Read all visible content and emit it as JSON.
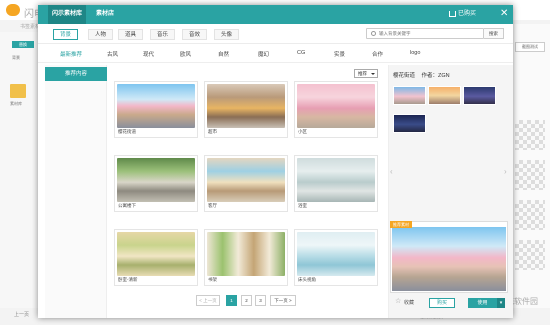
{
  "background_app": {
    "brand": "闪电",
    "subtitle": "书签素材",
    "left_button": "替换",
    "left_label_1": "背景",
    "left_label_2": "素材库",
    "bottom_text": "上一页",
    "bottom_right": "在线教程设计",
    "right_tab": "截图测试"
  },
  "watermark": "系统软件园",
  "dialog": {
    "tabs": [
      {
        "label": "闪示素材库"
      },
      {
        "label": "素材店"
      }
    ],
    "cart_label": "已购买",
    "close": "✕",
    "categories": [
      {
        "label": "背景"
      },
      {
        "label": "人物"
      },
      {
        "label": "道具"
      },
      {
        "label": "音乐"
      },
      {
        "label": "音效"
      },
      {
        "label": "头像"
      }
    ],
    "search": {
      "placeholder": "输入背景关键字",
      "button": "搜索"
    },
    "subcategories": [
      {
        "label": "最新推荐"
      },
      {
        "label": "古风"
      },
      {
        "label": "现代"
      },
      {
        "label": "欧风"
      },
      {
        "label": "自然"
      },
      {
        "label": "魔幻"
      },
      {
        "label": "CG"
      },
      {
        "label": "实景"
      },
      {
        "label": "合作"
      },
      {
        "label": "logo"
      }
    ],
    "sidebar_item": "推荐内容",
    "sort_value": "推荐",
    "cards": [
      {
        "label": "樱花街道"
      },
      {
        "label": "超市"
      },
      {
        "label": "小区"
      },
      {
        "label": "公寓楼下"
      },
      {
        "label": "客厅"
      },
      {
        "label": "浴室"
      },
      {
        "label": "卧室-清新"
      },
      {
        "label": "书架"
      },
      {
        "label": "床头视角"
      }
    ],
    "pager": {
      "prev": "< 上一页",
      "pages": [
        "1",
        "2",
        "3"
      ],
      "next": "下一页 >"
    },
    "right_panel": {
      "title": "樱花街道",
      "author": "作者：ZGN",
      "badge": "推荐素材",
      "favorite": "收藏",
      "buy": "购买",
      "use": "使用",
      "more": "▾",
      "prev_arrow": "‹",
      "next_arrow": "›"
    }
  }
}
